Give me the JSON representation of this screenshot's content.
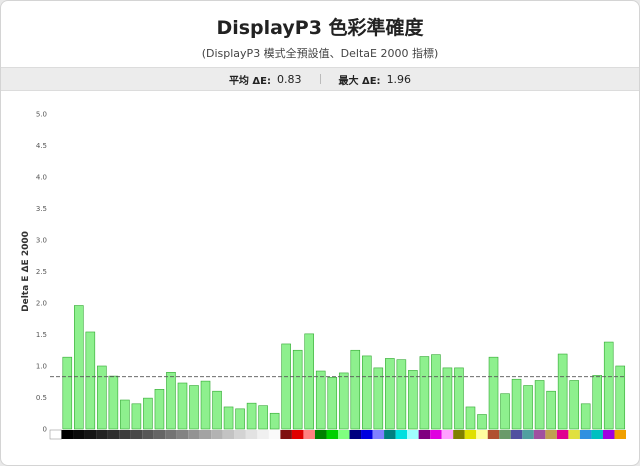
{
  "header": {
    "title": "DisplayP3 色彩準確度",
    "subtitle": "(DisplayP3 模式全預設值、DeltaE 2000 指標)"
  },
  "stats": {
    "avg_label": "平均 ΔE:",
    "avg_value": "0.83",
    "max_label": "最大 ΔE:",
    "max_value": "1.96"
  },
  "chart_data": {
    "type": "bar",
    "title": "DisplayP3 色彩準確度",
    "subtitle": "(DisplayP3 模式全預設值、DeltaE 2000 指標)",
    "ylabel": "Delta E ΔE 2000",
    "xlabel": "",
    "ylim": [
      0,
      5
    ],
    "yticks": [
      "0",
      "0.5",
      "1.0",
      "1.5",
      "2.0",
      "2.5",
      "3.0",
      "3.5",
      "4.0",
      "4.5",
      "5.0"
    ],
    "average_line": 0.83,
    "grid": false,
    "bar_color": "#8ef08e",
    "bar_border": "#33a833",
    "average_line_color": "#555555",
    "values": [
      0,
      1.14,
      1.96,
      1.54,
      1.0,
      0.84,
      0.46,
      0.4,
      0.49,
      0.63,
      0.9,
      0.73,
      0.69,
      0.76,
      0.6,
      0.35,
      0.32,
      0.41,
      0.37,
      0.25,
      1.35,
      1.25,
      1.51,
      0.92,
      0.82,
      0.89,
      1.25,
      1.16,
      0.97,
      1.12,
      1.1,
      0.93,
      1.15,
      1.18,
      0.97,
      0.97,
      0.35,
      0.23,
      1.14,
      0.56,
      0.79,
      0.69,
      0.77,
      0.6,
      1.19,
      0.77,
      0.4,
      0.85,
      1.38,
      1.0
    ],
    "swatches": [
      "#ffffff",
      "#000000",
      "#0a0a0a",
      "#151515",
      "#222222",
      "#2e2e2e",
      "#3b3b3b",
      "#494949",
      "#575757",
      "#656565",
      "#747474",
      "#838383",
      "#939393",
      "#a3a3a3",
      "#b3b3b3",
      "#c3c3c3",
      "#d3d3d3",
      "#e2e2e2",
      "#f0f0f0",
      "#fafafa",
      "#7f1010",
      "#e00000",
      "#ff8080",
      "#008000",
      "#00d000",
      "#80ff80",
      "#000080",
      "#0000e0",
      "#8080ff",
      "#008080",
      "#00e0e0",
      "#a0ffff",
      "#800080",
      "#e000e0",
      "#ffa0ff",
      "#808000",
      "#e0e000",
      "#ffffa0",
      "#b05030",
      "#6a9a6a",
      "#5050a0",
      "#50a0a0",
      "#a050a0",
      "#c0a050",
      "#e00090",
      "#e0e040",
      "#3090e0",
      "#00c0c0",
      "#a000e0",
      "#f0a000"
    ]
  }
}
